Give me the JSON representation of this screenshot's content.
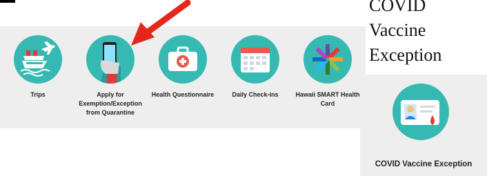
{
  "tiles": [
    {
      "label": "Trips",
      "icon": "cruise-ship-plane-icon",
      "color": "#36b9b2"
    },
    {
      "label": "Apply for Exemption/Exception from Quarantine",
      "icon": "phone-hand-icon",
      "color": "#36b9b2"
    },
    {
      "label": "Health Questionnaire",
      "icon": "medical-kit-icon",
      "color": "#36b9b2"
    },
    {
      "label": "Daily Check-ins",
      "icon": "calendar-icon",
      "color": "#36b9b2"
    },
    {
      "label": "Hawaii SMART Health Card",
      "icon": "smart-health-logo-icon",
      "color": "#36b9b2"
    }
  ],
  "annotation": {
    "arrow_color": "#e5271b"
  },
  "side": {
    "heading": "COVID Vaccine Exception",
    "tile_label": "COVID Vaccine Exception",
    "icon": "id-card-blood-drop-icon"
  }
}
